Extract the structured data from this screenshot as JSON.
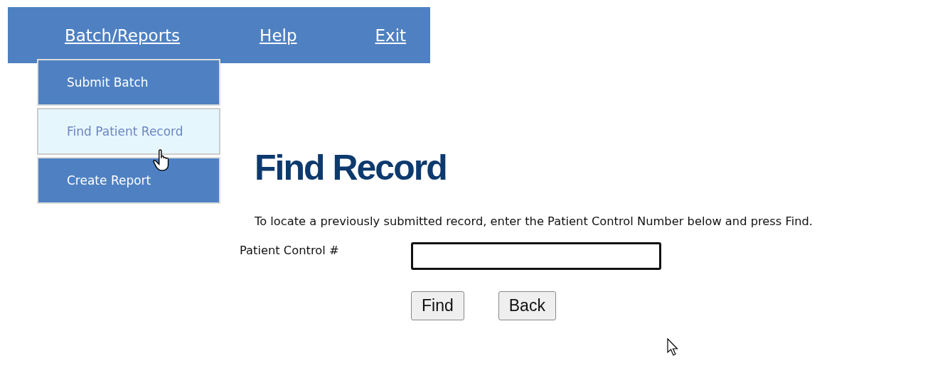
{
  "nav": {
    "items": [
      {
        "label": "Batch/Reports"
      },
      {
        "label": "Help"
      },
      {
        "label": "Exit"
      }
    ]
  },
  "dropdown": {
    "items": [
      {
        "label": "Submit Batch",
        "selected": false
      },
      {
        "label": "Find Patient Record",
        "selected": true
      },
      {
        "label": "Create Report",
        "selected": false
      }
    ]
  },
  "heading": "Find Record",
  "instructions": "To locate a previously submitted record, enter the Patient Control Number below and press Find.",
  "field": {
    "label": "Patient Control #",
    "focused": true
  },
  "buttons": [
    "Find",
    "Back"
  ]
}
